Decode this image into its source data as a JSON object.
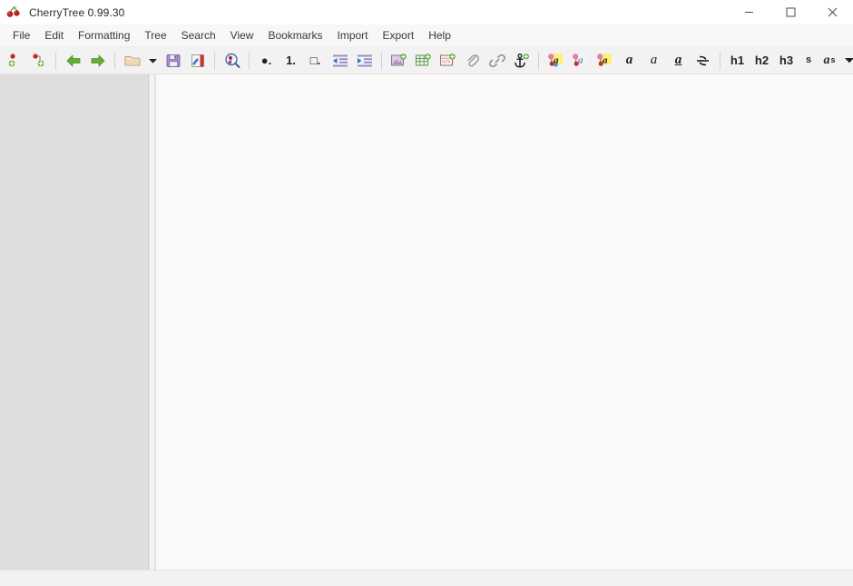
{
  "window": {
    "title": "CherryTree 0.99.30",
    "app_icon": "cherry-icon",
    "minimize_label": "—",
    "maximize_label": "□",
    "close_label": "✕"
  },
  "menubar": {
    "items": [
      {
        "label": "File"
      },
      {
        "label": "Edit"
      },
      {
        "label": "Formatting"
      },
      {
        "label": "Tree"
      },
      {
        "label": "Search"
      },
      {
        "label": "View"
      },
      {
        "label": "Bookmarks"
      },
      {
        "label": "Import"
      },
      {
        "label": "Export"
      },
      {
        "label": "Help"
      }
    ]
  },
  "toolbar": {
    "groups": [
      {
        "name": "node-group",
        "buttons": [
          {
            "icon": "new-node-icon",
            "label": ""
          },
          {
            "icon": "new-subnode-icon",
            "label": ""
          }
        ]
      },
      {
        "name": "navigation-group",
        "buttons": [
          {
            "icon": "go-back-icon",
            "label": ""
          },
          {
            "icon": "go-forward-icon",
            "label": ""
          }
        ]
      },
      {
        "name": "file-group",
        "buttons": [
          {
            "icon": "open-folder-icon",
            "label": ""
          },
          {
            "icon": "chevron-down-icon",
            "label": ""
          },
          {
            "icon": "save-icon",
            "label": ""
          },
          {
            "icon": "save-as-icon",
            "label": ""
          }
        ]
      },
      {
        "name": "search-group",
        "buttons": [
          {
            "icon": "find-icon",
            "label": ""
          }
        ]
      },
      {
        "name": "list-group",
        "buttons": [
          {
            "icon": "bullet-list-icon",
            "label": "●."
          },
          {
            "icon": "numbered-list-icon",
            "label": "1."
          },
          {
            "icon": "todo-list-icon",
            "label": "□."
          },
          {
            "icon": "decrease-indent-icon",
            "label": ""
          },
          {
            "icon": "increase-indent-icon",
            "label": ""
          }
        ]
      },
      {
        "name": "insert-group",
        "buttons": [
          {
            "icon": "insert-image-icon",
            "label": ""
          },
          {
            "icon": "insert-table-icon",
            "label": ""
          },
          {
            "icon": "insert-codebox-icon",
            "label": ""
          },
          {
            "icon": "attach-file-icon",
            "label": ""
          },
          {
            "icon": "insert-link-icon",
            "label": ""
          },
          {
            "icon": "insert-anchor-icon",
            "label": ""
          }
        ]
      },
      {
        "name": "format-group",
        "buttons": [
          {
            "icon": "foreground-color-icon",
            "label": "a"
          },
          {
            "icon": "background-color-icon",
            "label": "a"
          },
          {
            "icon": "highlight-color-icon",
            "label": "a"
          },
          {
            "icon": "bold-icon",
            "label": "a"
          },
          {
            "icon": "italic-icon",
            "label": "a"
          },
          {
            "icon": "underline-icon",
            "label": "a"
          },
          {
            "icon": "strikethrough-icon",
            "label": ""
          }
        ]
      },
      {
        "name": "heading-group",
        "buttons": [
          {
            "icon": "heading-1-icon",
            "label": "h1"
          },
          {
            "icon": "heading-2-icon",
            "label": "h2"
          },
          {
            "icon": "heading-3-icon",
            "label": "h3"
          },
          {
            "icon": "small-text-icon",
            "label": "s"
          },
          {
            "icon": "superscript-icon",
            "label": "a"
          },
          {
            "icon": "toolbar-overflow-icon",
            "label": ""
          }
        ]
      }
    ],
    "superscript_exponent": "s"
  },
  "tree_pane": {
    "nodes": []
  },
  "editor": {
    "content": "",
    "placeholder": ""
  },
  "statusbar": {
    "text": ""
  },
  "colors": {
    "titlebar_bg": "#ffffff",
    "menubar_bg": "#f7f7f7",
    "toolbar_bg": "#f2f2f2",
    "tree_pane_bg": "#dedede",
    "editor_bg": "#faf9f7",
    "accent_green": "#5aa02c",
    "cherry_red": "#cc2222",
    "save_purple": "#9b7fc4"
  }
}
